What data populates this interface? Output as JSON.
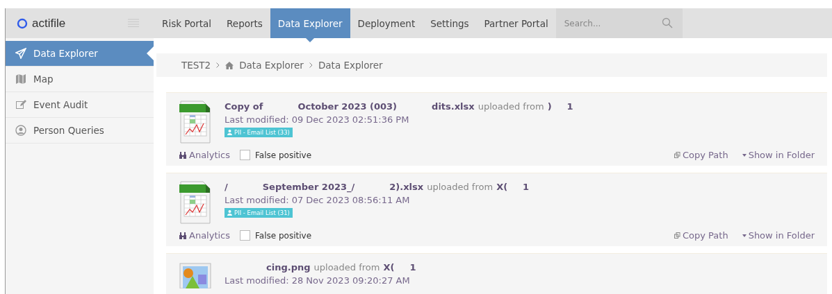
{
  "brand": "actifile",
  "nav": [
    {
      "label": "Risk Portal",
      "selected": false
    },
    {
      "label": "Reports",
      "selected": false
    },
    {
      "label": "Data Explorer",
      "selected": true
    },
    {
      "label": "Deployment",
      "selected": false
    },
    {
      "label": "Settings",
      "selected": false
    },
    {
      "label": "Partner Portal",
      "selected": false
    }
  ],
  "search": {
    "placeholder": "Search..."
  },
  "sidebar": {
    "items": [
      {
        "label": "Data Explorer",
        "selected": true
      },
      {
        "label": "Map",
        "selected": false
      },
      {
        "label": "Event Audit",
        "selected": false
      },
      {
        "label": "Person Queries",
        "selected": false
      }
    ]
  },
  "breadcrumb": [
    "TEST2",
    "Data Explorer",
    "Data Explorer"
  ],
  "files": [
    {
      "kind": "xls",
      "name_parts": [
        "Copy of",
        "October 2023 (003)",
        "dits.xlsx"
      ],
      "uploaded": "uploaded from",
      "source_parts": [
        ")",
        "1"
      ],
      "modified": "Last modified: 09 Dec 2023 02:51:36 PM",
      "tag": "PII - Email List (33)",
      "analytics": "Analytics",
      "false_positive": {
        "label": "False positive",
        "checked": false
      },
      "copy_path": "Copy Path",
      "show_in_folder": "Show in Folder"
    },
    {
      "kind": "xls",
      "name_parts": [
        "/",
        "September 2023_/",
        "2).xlsx"
      ],
      "uploaded": "uploaded from",
      "source_parts": [
        "X(",
        "1"
      ],
      "modified": "Last modified: 07 Dec 2023 08:56:11 AM",
      "tag": "PII - Email List (31)",
      "analytics": "Analytics",
      "false_positive": {
        "label": "False positive",
        "checked": false
      },
      "copy_path": "Copy Path",
      "show_in_folder": "Show in Folder"
    },
    {
      "kind": "image",
      "name_parts": [
        "cing.png"
      ],
      "uploaded": "uploaded from",
      "source_parts": [
        "X(",
        "1"
      ],
      "modified": "Last modified: 28 Nov 2023 09:20:27 AM"
    }
  ]
}
